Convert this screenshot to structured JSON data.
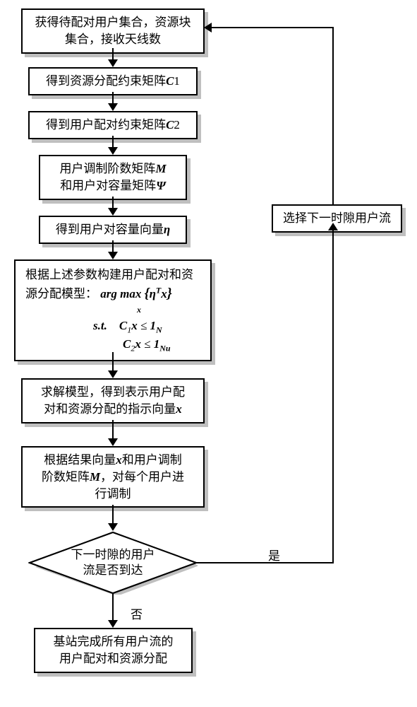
{
  "boxes": {
    "b1": "获得待配对用户集合，资源块集合，接收天线数",
    "b2_pre": "得到资源分配约束矩阵",
    "b2_var": "C",
    "b2_sub": "1",
    "b3_pre": "得到用户配对约束矩阵",
    "b3_var": "C",
    "b3_sub": "2",
    "b4_l1_pre": "用户调制阶数矩阵",
    "b4_l1_var": "M",
    "b4_l2_pre": "和用户对容量矩阵",
    "b4_l2_var": "Ψ",
    "b5_pre": "得到用户对容量向量",
    "b5_var": "η",
    "b6_l1": "根据上述参数构建用户配对和资源分配模型：",
    "b6_f1": "arg max",
    "b6_f1_under": "x",
    "b6_f1_brace_l": "{",
    "b6_f1_eta": "η",
    "b6_f1_T": "T",
    "b6_f1_x": "x",
    "b6_f1_brace_r": "}",
    "b6_f2_st": "s.t.",
    "b6_f2_c1": "C",
    "b6_f2_c1sub": "1",
    "b6_f2_x": "x",
    "b6_f2_le": "≤",
    "b6_f2_1": "1",
    "b6_f2_N": "N",
    "b6_f3_c2": "C",
    "b6_f3_c2sub": "2",
    "b6_f3_x": "x",
    "b6_f3_le": "≤",
    "b6_f3_1": "1",
    "b6_f3_Nu": "Nu",
    "b7_l1": "求解模型，得到表示用户配",
    "b7_l2_pre": "对和资源分配的指示向量",
    "b7_l2_var": "x",
    "b8_l1_pre": "根据结果向量",
    "b8_l1_var": "x",
    "b8_l1_post": "和用户调制",
    "b8_l2_pre": "阶数矩阵",
    "b8_l2_var": "M",
    "b8_l2_post": "，对每个用户进",
    "b8_l3": "行调制",
    "d1_l1": "下一时隙的用户",
    "d1_l2": "流是否到达",
    "b9": "选择下一时隙用户流",
    "b10_l1": "基站完成所有用户流的",
    "b10_l2": "用户配对和资源分配",
    "label_yes": "是",
    "label_no": "否"
  },
  "chart_data": {
    "type": "flowchart",
    "nodes": [
      {
        "id": "b1",
        "type": "process",
        "text": "获得待配对用户集合，资源块集合，接收天线数"
      },
      {
        "id": "b2",
        "type": "process",
        "text": "得到资源分配约束矩阵 C1"
      },
      {
        "id": "b3",
        "type": "process",
        "text": "得到用户配对约束矩阵 C2"
      },
      {
        "id": "b4",
        "type": "process",
        "text": "用户调制阶数矩阵 M 和用户对容量矩阵 Ψ"
      },
      {
        "id": "b5",
        "type": "process",
        "text": "得到用户对容量向量 η"
      },
      {
        "id": "b6",
        "type": "process",
        "text": "根据上述参数构建用户配对和资源分配模型: arg max_x {η^T x}  s.t.  C1 x ≤ 1_N,  C2 x ≤ 1_Nu"
      },
      {
        "id": "b7",
        "type": "process",
        "text": "求解模型，得到表示用户配对和资源分配的指示向量 x"
      },
      {
        "id": "b8",
        "type": "process",
        "text": "根据结果向量 x 和用户调制阶数矩阵 M，对每个用户进行调制"
      },
      {
        "id": "d1",
        "type": "decision",
        "text": "下一时隙的用户流是否到达"
      },
      {
        "id": "b9",
        "type": "process",
        "text": "选择下一时隙用户流"
      },
      {
        "id": "b10",
        "type": "terminal",
        "text": "基站完成所有用户流的用户配对和资源分配"
      }
    ],
    "edges": [
      {
        "from": "b1",
        "to": "b2"
      },
      {
        "from": "b2",
        "to": "b3"
      },
      {
        "from": "b3",
        "to": "b4"
      },
      {
        "from": "b4",
        "to": "b5"
      },
      {
        "from": "b5",
        "to": "b6"
      },
      {
        "from": "b6",
        "to": "b7"
      },
      {
        "from": "b7",
        "to": "b8"
      },
      {
        "from": "b8",
        "to": "d1"
      },
      {
        "from": "d1",
        "to": "b9",
        "label": "是"
      },
      {
        "from": "d1",
        "to": "b10",
        "label": "否"
      },
      {
        "from": "b9",
        "to": "b1"
      }
    ]
  }
}
